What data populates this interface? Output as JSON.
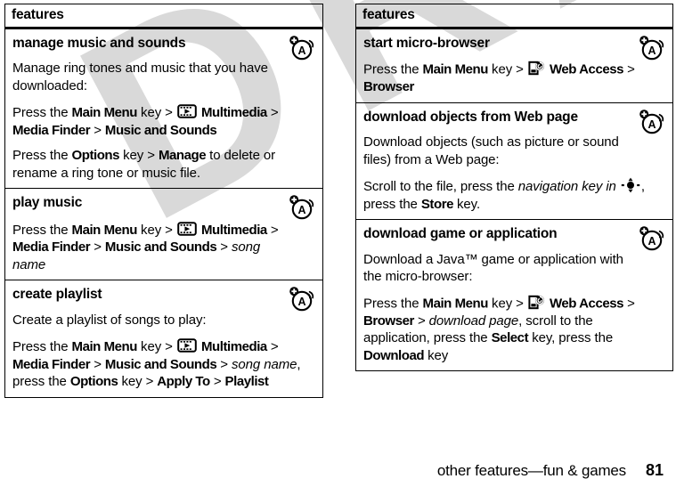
{
  "document": {
    "watermark_text": "DRAFT",
    "watermark_color": "#d9d9d9"
  },
  "footer": {
    "title": "other features—fun & games",
    "page_number": "81"
  },
  "left_table": {
    "header": "features",
    "rows": [
      {
        "title": "manage music and sounds",
        "badge_icon": "network-a-icon",
        "paragraphs": [
          [
            {
              "t": "Manage ring tones and music that you have downloaded:",
              "s": "n"
            }
          ],
          [
            {
              "t": "Press the ",
              "s": "n"
            },
            {
              "t": "Main Menu",
              "s": "b"
            },
            {
              "t": " key > ",
              "s": "n"
            },
            {
              "t": "multimedia-icon",
              "s": "icon"
            },
            {
              "t": " ",
              "s": "n"
            },
            {
              "t": "Multimedia",
              "s": "b"
            },
            {
              "t": " > ",
              "s": "n"
            },
            {
              "t": "Media Finder",
              "s": "b"
            },
            {
              "t": " > ",
              "s": "n"
            },
            {
              "t": "Music and Sounds",
              "s": "b"
            }
          ],
          [
            {
              "t": "Press the ",
              "s": "n"
            },
            {
              "t": "Options",
              "s": "b"
            },
            {
              "t": " key > ",
              "s": "n"
            },
            {
              "t": "Manage",
              "s": "b"
            },
            {
              "t": " to delete or rename a ring tone or music file.",
              "s": "n"
            }
          ]
        ]
      },
      {
        "title": "play music",
        "badge_icon": "network-a-icon",
        "paragraphs": [
          [
            {
              "t": "Press the ",
              "s": "n"
            },
            {
              "t": "Main Menu",
              "s": "b"
            },
            {
              "t": " key > ",
              "s": "n"
            },
            {
              "t": "multimedia-icon",
              "s": "icon"
            },
            {
              "t": " ",
              "s": "n"
            },
            {
              "t": "Multimedia",
              "s": "b"
            },
            {
              "t": " > ",
              "s": "n"
            },
            {
              "t": "Media Finder",
              "s": "b"
            },
            {
              "t": " > ",
              "s": "n"
            },
            {
              "t": "Music and Sounds",
              "s": "b"
            },
            {
              "t": " > ",
              "s": "n"
            },
            {
              "t": "song name",
              "s": "i"
            }
          ]
        ]
      },
      {
        "title": "create playlist",
        "badge_icon": "network-a-icon",
        "paragraphs": [
          [
            {
              "t": "Create a playlist of songs to play:",
              "s": "n"
            }
          ],
          [
            {
              "t": "Press the ",
              "s": "n"
            },
            {
              "t": "Main Menu",
              "s": "b"
            },
            {
              "t": " key > ",
              "s": "n"
            },
            {
              "t": "multimedia-icon",
              "s": "icon"
            },
            {
              "t": " ",
              "s": "n"
            },
            {
              "t": "Multimedia",
              "s": "b"
            },
            {
              "t": " > ",
              "s": "n"
            },
            {
              "t": "Media Finder",
              "s": "b"
            },
            {
              "t": " > ",
              "s": "n"
            },
            {
              "t": "Music and Sounds",
              "s": "b"
            },
            {
              "t": " > ",
              "s": "n"
            },
            {
              "t": "song name",
              "s": "i"
            },
            {
              "t": ", press the ",
              "s": "n"
            },
            {
              "t": "Options",
              "s": "b"
            },
            {
              "t": " key > ",
              "s": "n"
            },
            {
              "t": "Apply To",
              "s": "b"
            },
            {
              "t": " > ",
              "s": "n"
            },
            {
              "t": "Playlist",
              "s": "b"
            }
          ]
        ]
      }
    ]
  },
  "right_table": {
    "header": "features",
    "rows": [
      {
        "title": "start micro-browser",
        "badge_icon": "network-a-icon",
        "paragraphs": [
          [
            {
              "t": "Press the ",
              "s": "n"
            },
            {
              "t": "Main Menu",
              "s": "b"
            },
            {
              "t": " key > ",
              "s": "n"
            },
            {
              "t": "web-access-icon",
              "s": "icon"
            },
            {
              "t": " ",
              "s": "n"
            },
            {
              "t": "Web Access",
              "s": "b"
            },
            {
              "t": " > ",
              "s": "n"
            },
            {
              "t": "Browser",
              "s": "b"
            }
          ]
        ]
      },
      {
        "title": "download objects from Web page",
        "badge_icon": "network-a-icon",
        "paragraphs": [
          [
            {
              "t": "Download objects (such as picture or sound files) from a Web page:",
              "s": "n"
            }
          ],
          [
            {
              "t": "Scroll to the file, press the ",
              "s": "n"
            },
            {
              "t": "navigation key in",
              "s": "i"
            },
            {
              "t": " ",
              "s": "n"
            },
            {
              "t": "navigation-key-icon",
              "s": "icon"
            },
            {
              "t": ", press the ",
              "s": "n"
            },
            {
              "t": "Store",
              "s": "b"
            },
            {
              "t": " key.",
              "s": "n"
            }
          ]
        ]
      },
      {
        "title": "download game or application",
        "badge_icon": "network-a-icon",
        "paragraphs": [
          [
            {
              "t": "Download a Java™ game or application with the micro-browser:",
              "s": "n"
            }
          ],
          [
            {
              "t": "Press the ",
              "s": "n"
            },
            {
              "t": "Main Menu",
              "s": "b"
            },
            {
              "t": " key > ",
              "s": "n"
            },
            {
              "t": "web-access-icon",
              "s": "icon"
            },
            {
              "t": " ",
              "s": "n"
            },
            {
              "t": "Web Access",
              "s": "b"
            },
            {
              "t": " > ",
              "s": "n"
            },
            {
              "t": "Browser",
              "s": "b"
            },
            {
              "t": " > ",
              "s": "n"
            },
            {
              "t": "download page",
              "s": "i"
            },
            {
              "t": ", scroll to the application, press the ",
              "s": "n"
            },
            {
              "t": "Select",
              "s": "b"
            },
            {
              "t": " key, press the ",
              "s": "n"
            },
            {
              "t": "Download",
              "s": "b"
            },
            {
              "t": " key",
              "s": "n"
            }
          ]
        ]
      }
    ]
  }
}
